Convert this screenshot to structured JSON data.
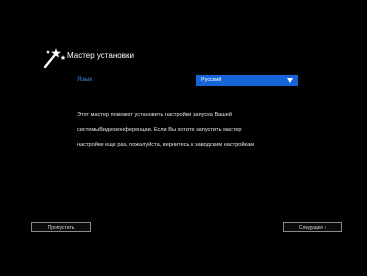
{
  "wizard": {
    "title": "Мастер установки",
    "icon": "magic-wand-icon"
  },
  "language": {
    "label": "Язык",
    "selected": "Русский"
  },
  "description": {
    "line1": "Этот мастер поможет установить настройки запуска Вашей",
    "line2": "системыВидеоконференции. Если Вы хотите запустить мастер",
    "line3": "настройки еще раз, пожалуйста, вернитесь к заводским настройкам"
  },
  "buttons": {
    "skip": "Пропустить",
    "next": "Следущее ›"
  },
  "colors": {
    "background": "#000000",
    "accent": "#1565d8",
    "label": "#3a8be6"
  }
}
